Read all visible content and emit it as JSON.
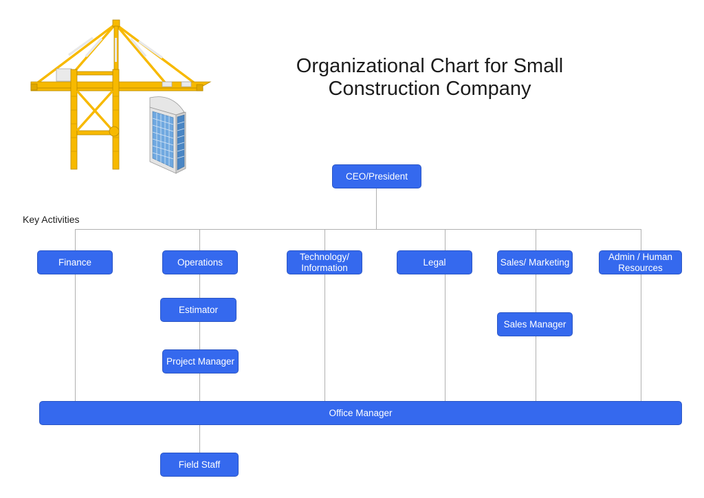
{
  "title": "Organizational Chart for Small Construction Company",
  "section_label": "Key Activities",
  "colors": {
    "box_fill": "#3569ee",
    "connector": "#b0b0b0",
    "crane": "#f7b900",
    "building_glass": "#5b9bd5"
  },
  "illustration": {
    "crane": "gantry-crane-icon",
    "building": "office-building-icon"
  },
  "nodes": {
    "ceo": "CEO/President",
    "finance": "Finance",
    "operations": "Operations",
    "technology": "Technology/ Information",
    "legal": "Legal",
    "sales": "Sales/ Marketing",
    "admin": "Admin / Human Resources",
    "estimator": "Estimator",
    "project_manager": "Project Manager",
    "sales_manager": "Sales Manager",
    "office_manager": "Office Manager",
    "field_staff": "Field Staff"
  }
}
